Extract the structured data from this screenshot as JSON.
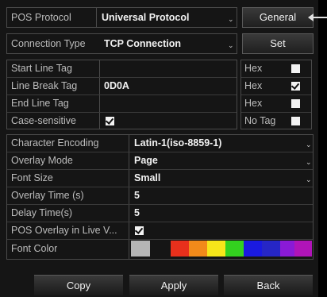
{
  "pos_protocol": {
    "label": "POS Protocol",
    "value": "Universal Protocol"
  },
  "general_button": "General",
  "connection_type": {
    "label": "Connection Type",
    "value": "TCP Connection"
  },
  "set_button": "Set",
  "tags": [
    {
      "label": "Start Line Tag",
      "value": "",
      "side_label": "Hex",
      "side_checked": false
    },
    {
      "label": "Line Break Tag",
      "value": "0D0A",
      "side_label": "Hex",
      "side_checked": true
    },
    {
      "label": "End Line Tag",
      "value": "",
      "side_label": "Hex",
      "side_checked": false
    },
    {
      "label": "Case-sensitive",
      "value_checked": true,
      "side_label": "No Tag",
      "side_checked": false
    }
  ],
  "settings": {
    "character_encoding": {
      "label": "Character Encoding",
      "value": "Latin-1(iso-8859-1)"
    },
    "overlay_mode": {
      "label": "Overlay Mode",
      "value": "Page"
    },
    "font_size": {
      "label": "Font Size",
      "value": "Small"
    },
    "overlay_time": {
      "label": "Overlay Time (s)",
      "value": "5"
    },
    "delay_time": {
      "label": "Delay Time(s)",
      "value": "5"
    },
    "pos_overlay_live": {
      "label": "POS Overlay in Live V...",
      "checked": true
    },
    "font_color": {
      "label": "Font Color",
      "selected": "#b5b5b5"
    }
  },
  "palette": [
    "#e8301c",
    "#f28a1a",
    "#f6e61a",
    "#33d11f",
    "#1a1ae0",
    "#2626c6",
    "#8a1ad6",
    "#b014b8"
  ],
  "buttons": {
    "copy": "Copy",
    "apply": "Apply",
    "back": "Back"
  }
}
